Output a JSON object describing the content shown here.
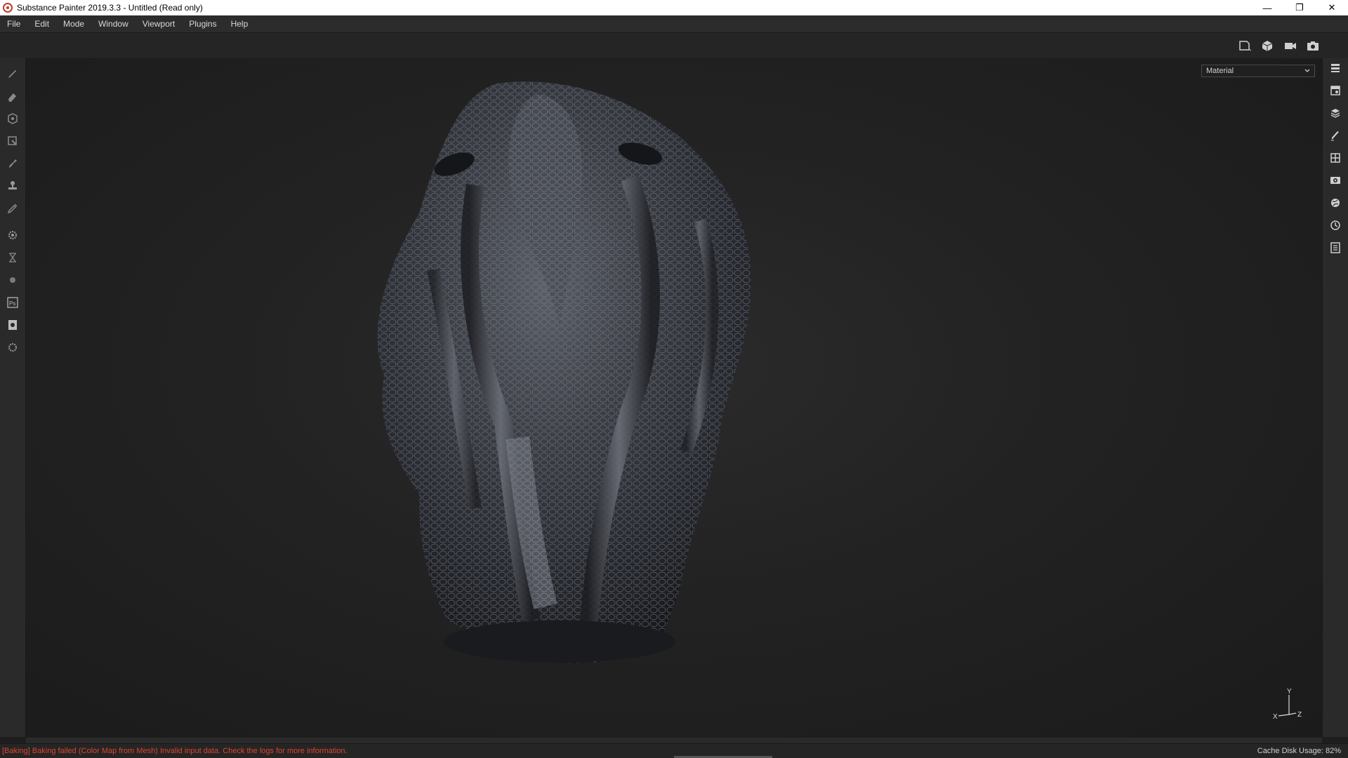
{
  "window": {
    "title": "Substance Painter 2019.3.3 - Untitled (Read only)",
    "minimize_glyph": "—",
    "maximize_glyph": "❐",
    "close_glyph": "✕"
  },
  "menu": {
    "items": [
      "File",
      "Edit",
      "Mode",
      "Window",
      "Viewport",
      "Plugins",
      "Help"
    ]
  },
  "viewport": {
    "display_mode": "Material",
    "axis": {
      "y": "Y",
      "x": "X",
      "z": "Z"
    }
  },
  "status": {
    "message": "[Baking] Baking failed (Color Map from Mesh) Invalid input data. Check the logs for more information.",
    "cache_label": "Cache Disk Usage:",
    "cache_value": "82%"
  },
  "colors": {
    "error": "#e0442e",
    "panel": "#2a2a2a",
    "viewport": "#1e1e1e"
  },
  "icons": {
    "left_tools": [
      "paint-brush-icon",
      "eraser-icon",
      "projection-icon",
      "polygon-fill-icon",
      "smudge-icon",
      "clone-stamp-icon",
      "color-picker-icon",
      "settings-gear-icon",
      "bake-icon",
      "iray-icon",
      "photoshop-export-icon",
      "export-textures-icon",
      "plugin-icon"
    ],
    "right_panels": [
      "texture-set-list-icon",
      "texture-set-settings-icon",
      "layers-icon",
      "properties-icon",
      "shelf-icon",
      "display-settings-icon",
      "viewer-settings-icon",
      "history-icon",
      "log-icon"
    ]
  }
}
